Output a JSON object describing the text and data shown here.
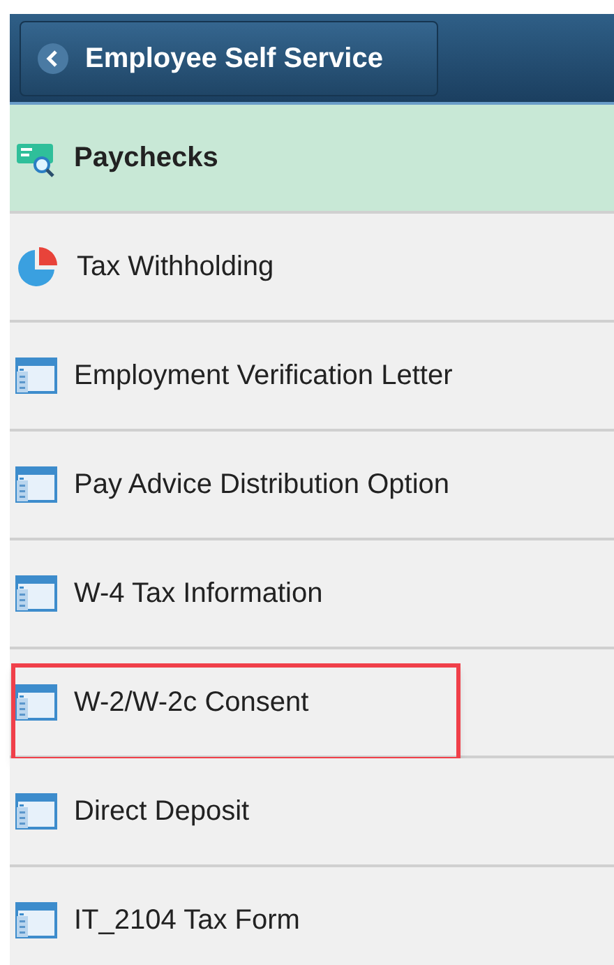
{
  "header": {
    "back_button": "Employee Self Service"
  },
  "items": [
    {
      "label": "Paychecks",
      "kind": "paycheck",
      "selected": true,
      "highlighted": false
    },
    {
      "label": "Tax Withholding",
      "kind": "pie",
      "selected": false,
      "highlighted": false
    },
    {
      "label": "Employment Verification Letter",
      "kind": "page",
      "selected": false,
      "highlighted": false
    },
    {
      "label": "Pay Advice Distribution Option",
      "kind": "page",
      "selected": false,
      "highlighted": false
    },
    {
      "label": "W-4 Tax Information",
      "kind": "page",
      "selected": false,
      "highlighted": false
    },
    {
      "label": "W-2/W-2c Consent",
      "kind": "page",
      "selected": false,
      "highlighted": true
    },
    {
      "label": "Direct Deposit",
      "kind": "page",
      "selected": false,
      "highlighted": false
    },
    {
      "label": "IT_2104 Tax Form",
      "kind": "page",
      "selected": false,
      "highlighted": false
    }
  ]
}
